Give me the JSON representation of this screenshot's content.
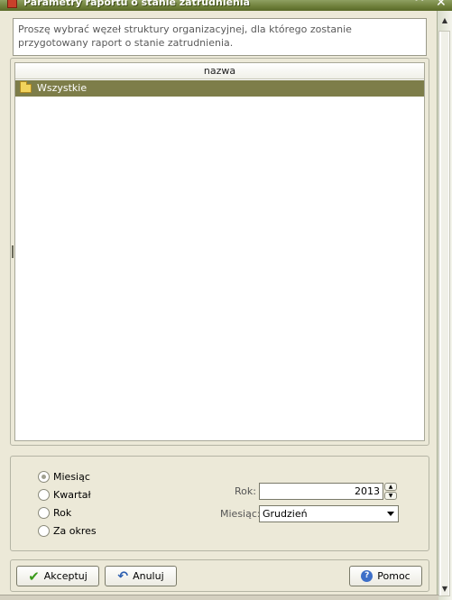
{
  "window": {
    "title": "Parametry raportu o stanie zatrudnienia",
    "collapse_glyph": "^",
    "close_glyph": "✕"
  },
  "info": "Proszę wybrać węzeł struktury organizacyjnej, dla którego zostanie przygotowany raport o stanie zatrudnienia.",
  "tree": {
    "column_header": "nazwa",
    "rows": [
      {
        "label": "Wszystkie",
        "icon": "folder-icon",
        "selected": true
      }
    ]
  },
  "period": {
    "options": [
      "Miesiąc",
      "Kwartał",
      "Rok",
      "Za okres"
    ],
    "selected_option": "Miesiąc",
    "year_label": "Rok:",
    "year_value": "2013",
    "month_label": "Miesiąc:",
    "month_value": "Grudzień"
  },
  "buttons": {
    "accept": "Akceptuj",
    "cancel": "Anuluj",
    "help": "Pomoc",
    "help_glyph": "?"
  },
  "colors": {
    "title_bar": "#6e7f3a",
    "selected_row": "#7d7d49",
    "window_bg": "#ece9d8"
  }
}
